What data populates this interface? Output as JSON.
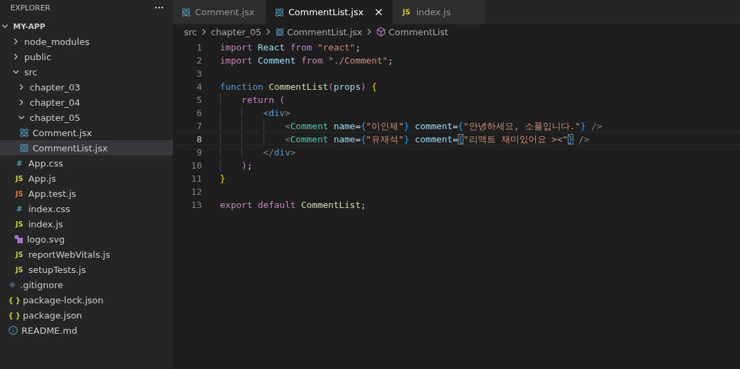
{
  "explorer": {
    "title": "EXPLORER"
  },
  "tree": [
    {
      "name": "MY-APP",
      "kind": "root",
      "expanded": true,
      "selected": false,
      "children": [
        {
          "name": "node_modules",
          "kind": "folder",
          "expanded": false,
          "selected": false
        },
        {
          "name": "public",
          "kind": "folder",
          "expanded": false,
          "selected": false
        },
        {
          "name": "src",
          "kind": "folder",
          "expanded": true,
          "selected": false,
          "children": [
            {
              "name": "chapter_03",
              "kind": "folder",
              "expanded": false,
              "selected": false
            },
            {
              "name": "chapter_04",
              "kind": "folder",
              "expanded": false,
              "selected": false
            },
            {
              "name": "chapter_05",
              "kind": "folder",
              "expanded": true,
              "selected": false,
              "children": [
                {
                  "name": "Comment.jsx",
                  "kind": "react",
                  "selected": false
                },
                {
                  "name": "CommentList.jsx",
                  "kind": "react",
                  "selected": true
                }
              ]
            },
            {
              "name": "App.css",
              "kind": "css",
              "icon_text": "#",
              "selected": false
            },
            {
              "name": "App.js",
              "kind": "js",
              "icon_text": "JS",
              "selected": false
            },
            {
              "name": "App.test.js",
              "kind": "test",
              "icon_text": "JS",
              "selected": false
            },
            {
              "name": "index.css",
              "kind": "css",
              "icon_text": "#",
              "selected": false
            },
            {
              "name": "index.js",
              "kind": "js",
              "icon_text": "JS",
              "selected": false
            },
            {
              "name": "logo.svg",
              "kind": "svg",
              "selected": false
            },
            {
              "name": "reportWebVitals.js",
              "kind": "js",
              "icon_text": "JS",
              "selected": false
            },
            {
              "name": "setupTests.js",
              "kind": "js",
              "icon_text": "JS",
              "selected": false
            }
          ]
        },
        {
          "name": ".gitignore",
          "kind": "git",
          "selected": false
        },
        {
          "name": "package-lock.json",
          "kind": "json",
          "icon_text": "{ }",
          "selected": false
        },
        {
          "name": "package.json",
          "kind": "json",
          "icon_text": "{ }",
          "selected": false
        },
        {
          "name": "README.md",
          "kind": "info",
          "selected": false
        }
      ]
    }
  ],
  "tabs": [
    {
      "label": "Comment.jsx",
      "kind": "react",
      "selected": false
    },
    {
      "label": "CommentList.jsx",
      "kind": "react",
      "selected": true
    },
    {
      "label": "index.js",
      "kind": "js",
      "icon_text": "JS",
      "selected": false
    }
  ],
  "breadcrumbs": [
    {
      "label": "src",
      "kind": "folder"
    },
    {
      "label": "chapter_05",
      "kind": "folder"
    },
    {
      "label": "CommentList.jsx",
      "kind": "react"
    },
    {
      "label": "CommentList",
      "kind": "component"
    }
  ],
  "code": [
    {
      "number": "1",
      "current": false,
      "tokens": [
        {
          "kind": "keyword",
          "text": "import "
        },
        {
          "kind": "variable",
          "text": "React "
        },
        {
          "kind": "keyword",
          "text": "from "
        },
        {
          "kind": "string",
          "text": "\"react\""
        },
        {
          "kind": "plain",
          "text": ";"
        }
      ]
    },
    {
      "number": "2",
      "current": false,
      "tokens": [
        {
          "kind": "keyword",
          "text": "import "
        },
        {
          "kind": "variable",
          "text": "Comment "
        },
        {
          "kind": "keyword",
          "text": "from "
        },
        {
          "kind": "string",
          "text": "\"./Comment\""
        },
        {
          "kind": "plain",
          "text": ";"
        }
      ]
    },
    {
      "number": "3",
      "current": false
    },
    {
      "number": "4",
      "current": false,
      "tokens": [
        {
          "kind": "storage",
          "text": "function "
        },
        {
          "kind": "function",
          "text": "CommentList"
        },
        {
          "kind": "bracket2",
          "text": "("
        },
        {
          "kind": "variable",
          "text": "props"
        },
        {
          "kind": "bracket2",
          "text": ")"
        },
        {
          "kind": "bracket1",
          "text": " {"
        }
      ]
    },
    {
      "number": "5",
      "current": false,
      "tokens": [
        {
          "kind": "keyword",
          "text": "    return "
        },
        {
          "kind": "bracket2",
          "text": "("
        }
      ]
    },
    {
      "number": "6",
      "current": false,
      "tokens": [
        {
          "kind": "tagmark",
          "text": "        <"
        },
        {
          "kind": "tag",
          "text": "div"
        },
        {
          "kind": "tagmark",
          "text": ">"
        }
      ]
    },
    {
      "number": "7",
      "current": false,
      "tokens": [
        {
          "kind": "tagmark",
          "text": "            <"
        },
        {
          "kind": "component",
          "text": "Comment "
        },
        {
          "kind": "variable",
          "text": "name"
        },
        {
          "kind": "plain",
          "text": "="
        },
        {
          "kind": "bracket3",
          "text": "{"
        },
        {
          "kind": "string",
          "text": "\"이인제\""
        },
        {
          "kind": "bracket3",
          "text": "}"
        },
        {
          "kind": "variable",
          "text": " comment"
        },
        {
          "kind": "plain",
          "text": "="
        },
        {
          "kind": "bracket3",
          "text": "{"
        },
        {
          "kind": "string",
          "text": "\"안녕하세요, 소플입니다.\""
        },
        {
          "kind": "bracket3",
          "text": "}"
        },
        {
          "kind": "tagmark",
          "text": " />"
        }
      ]
    },
    {
      "number": "8",
      "current": true,
      "tokens": [
        {
          "kind": "tagmark",
          "text": "            <"
        },
        {
          "kind": "component",
          "text": "Comment "
        },
        {
          "kind": "variable",
          "text": "name"
        },
        {
          "kind": "plain",
          "text": "="
        },
        {
          "kind": "bracket3",
          "text": "{"
        },
        {
          "kind": "string",
          "text": "\"유재석\""
        },
        {
          "kind": "bracket3",
          "text": "}"
        },
        {
          "kind": "variable",
          "text": " comment"
        },
        {
          "kind": "plain",
          "text": "="
        },
        {
          "kind": "bracket_match",
          "text": "{"
        },
        {
          "kind": "string",
          "text": "\"리액트 재미있어요 ><\""
        },
        {
          "kind": "bracket_match",
          "text": "}"
        },
        {
          "kind": "tagmark",
          "text": " />"
        }
      ]
    },
    {
      "number": "9",
      "current": false,
      "tokens": [
        {
          "kind": "tagmark",
          "text": "        </"
        },
        {
          "kind": "tag",
          "text": "div"
        },
        {
          "kind": "tagmark",
          "text": ">"
        }
      ]
    },
    {
      "number": "10",
      "current": false,
      "tokens": [
        {
          "kind": "bracket2",
          "text": "    )"
        },
        {
          "kind": "plain",
          "text": ";"
        }
      ]
    },
    {
      "number": "11",
      "current": false,
      "tokens": [
        {
          "kind": "bracket1",
          "text": "}"
        }
      ]
    },
    {
      "number": "12",
      "current": false
    },
    {
      "number": "13",
      "current": false,
      "tokens": [
        {
          "kind": "keyword",
          "text": "export default "
        },
        {
          "kind": "function",
          "text": "CommentList"
        },
        {
          "kind": "plain",
          "text": ";"
        }
      ]
    }
  ]
}
